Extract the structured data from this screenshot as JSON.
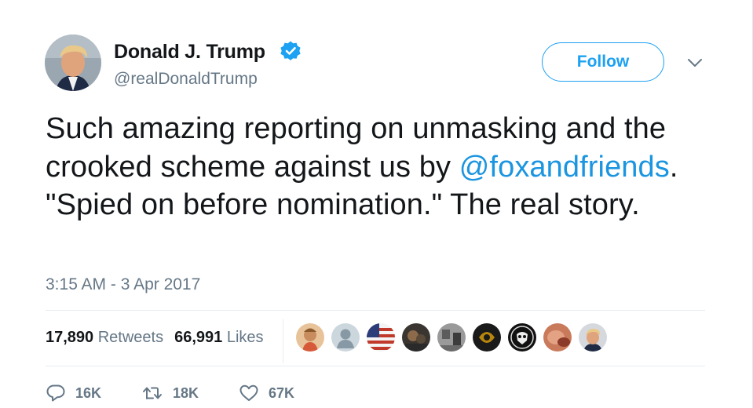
{
  "user": {
    "display_name": "Donald J. Trump",
    "handle": "@realDonaldTrump",
    "verified": true,
    "avatar_icon": "profile-photo"
  },
  "follow_button": {
    "label": "Follow"
  },
  "more_icon": "chevron-down-icon",
  "tweet": {
    "text_part1": "Such amazing reporting on unmasking and the crooked scheme against us by ",
    "mention": "@foxandfriends",
    "text_part2": ". \"Spied on before nomination.\" The real story.",
    "timestamp": "3:15 AM - 3 Apr 2017"
  },
  "stats": {
    "retweets_count": "17,890",
    "retweets_label": "Retweets",
    "likes_count": "66,991",
    "likes_label": "Likes"
  },
  "likers_count": 9,
  "actions": {
    "replies": "16K",
    "retweets": "18K",
    "likes": "67K"
  },
  "colors": {
    "accent": "#1da1f2",
    "mention": "#1b95e0",
    "secondary_text": "#657786",
    "divider": "#e6ecf0"
  }
}
